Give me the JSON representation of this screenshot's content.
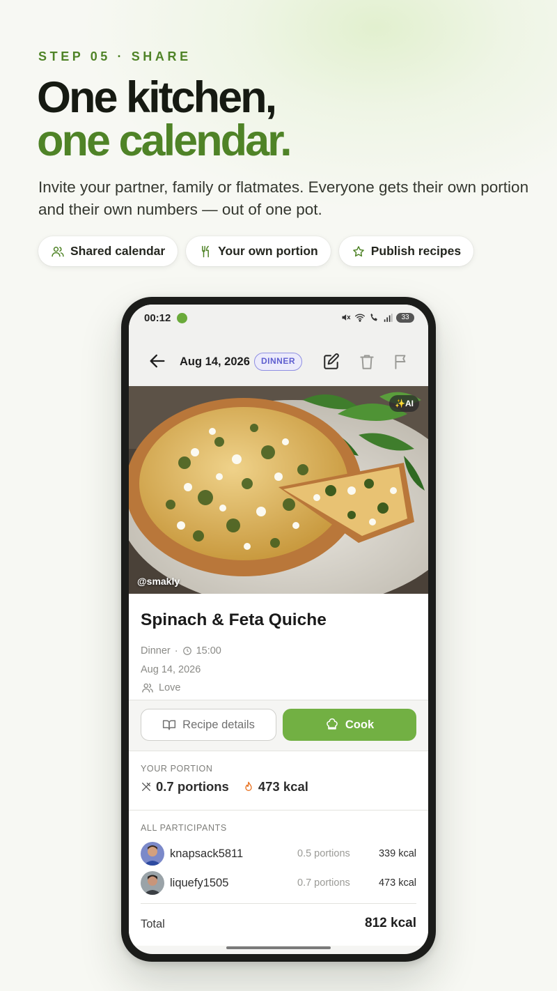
{
  "hero": {
    "eyebrow": "STEP 05 · SHARE",
    "headline_line1": "One kitchen,",
    "headline_line2": "one calendar.",
    "lede": "Invite your partner, family or flatmates. Everyone gets their own portion and their own numbers — out of one pot.",
    "accent_color": "#4f8327"
  },
  "chips": [
    {
      "icon": "people-icon",
      "label": "Shared calendar"
    },
    {
      "icon": "fork-knife-icon",
      "label": "Your own portion"
    },
    {
      "icon": "star-icon",
      "label": "Publish recipes"
    }
  ],
  "status_bar": {
    "time": "00:12",
    "battery": "33"
  },
  "app_bar": {
    "date": "Aug 14, 2026",
    "meal_badge": "DINNER"
  },
  "photo": {
    "ai_badge": "AI",
    "credit": "@smakly"
  },
  "recipe": {
    "title": "Spinach & Feta Quiche",
    "meal": "Dinner",
    "time": "15:00",
    "date": "Aug 14, 2026",
    "group": "Love"
  },
  "actions": {
    "recipe_details": "Recipe details",
    "cook": "Cook",
    "cook_color": "#72b043"
  },
  "your_portion": {
    "label": "YOUR PORTION",
    "portions": "0.7 portions",
    "kcal": "473 kcal"
  },
  "participants": {
    "label": "ALL PARTICIPANTS",
    "rows": [
      {
        "name": "knapsack5811",
        "portions": "0.5 portions",
        "kcal": "339 kcal"
      },
      {
        "name": "liquefy1505",
        "portions": "0.7 portions",
        "kcal": "473 kcal"
      }
    ],
    "total_label": "Total",
    "total_value": "812 kcal"
  }
}
